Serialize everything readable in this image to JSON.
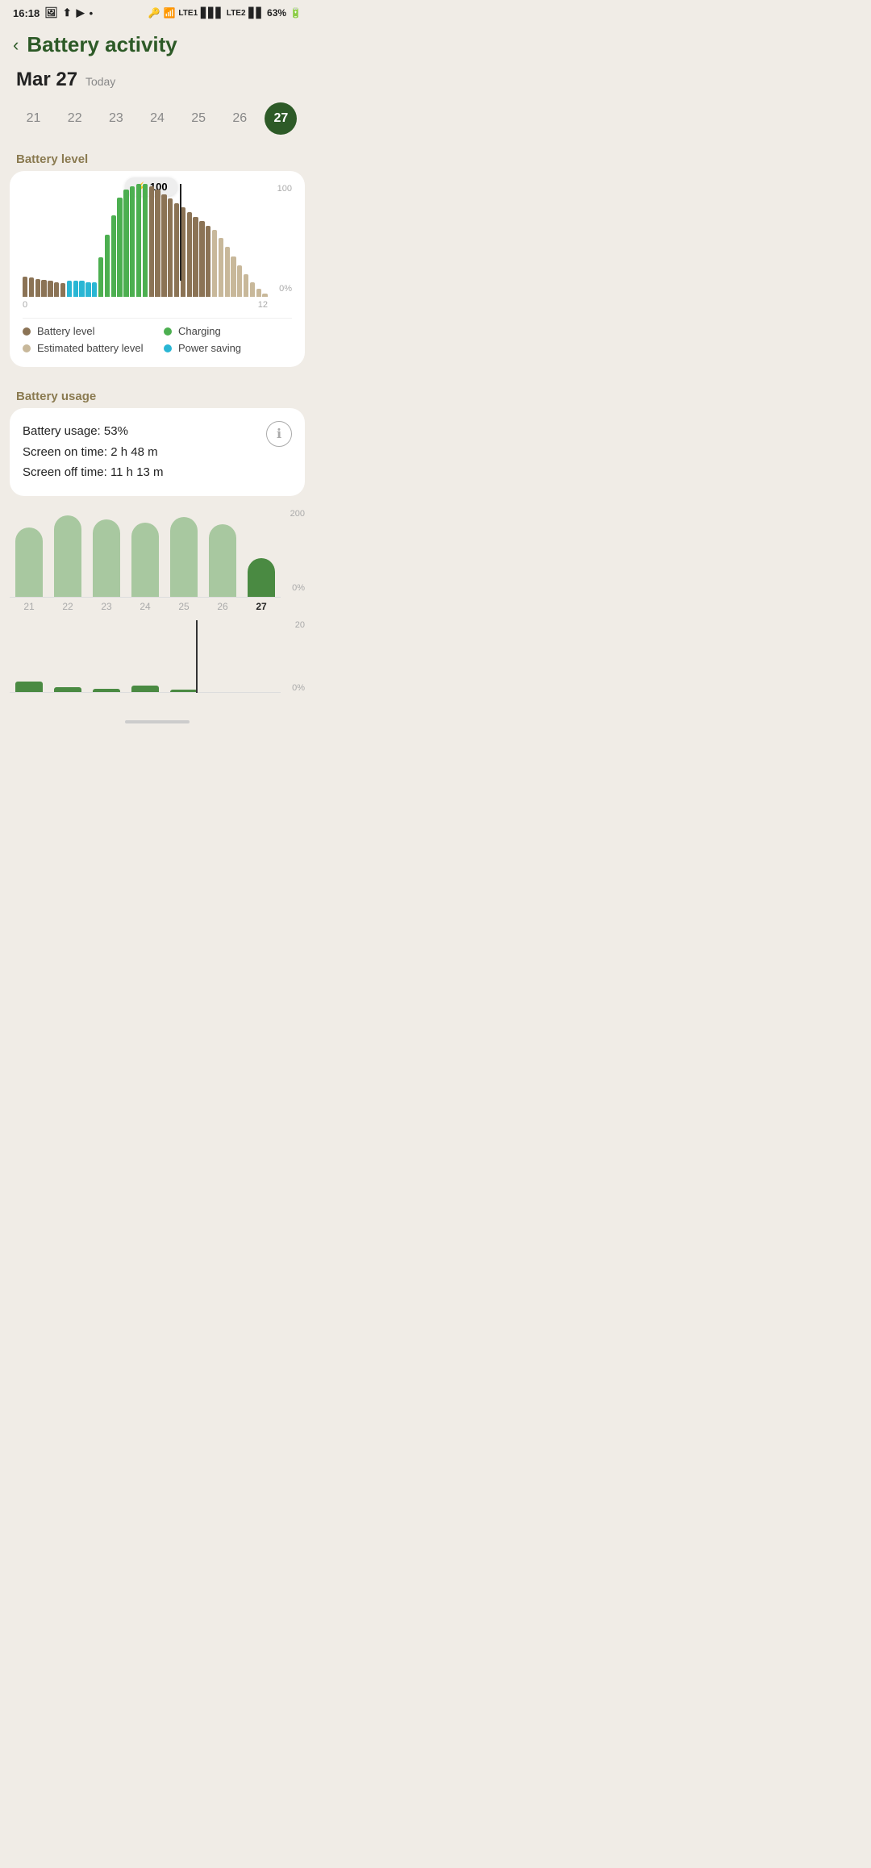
{
  "statusBar": {
    "time": "16:18",
    "battery": "63%"
  },
  "header": {
    "backLabel": "‹",
    "title": "Battery activity"
  },
  "dateSection": {
    "dateMain": "Mar 27",
    "dateSub": "Today"
  },
  "daySelector": {
    "days": [
      "21",
      "22",
      "23",
      "24",
      "25",
      "26",
      "27"
    ],
    "activeDay": "27"
  },
  "batteryLevelSection": {
    "label": "Battery level",
    "tooltip": "⚡ 100",
    "yLabelTop": "100",
    "yLabelBottom": "0%",
    "xLabelStart": "0",
    "xLabelMid": "12",
    "legend": [
      {
        "color": "#8b7355",
        "label": "Battery level"
      },
      {
        "color": "#4caf50",
        "label": "Charging"
      },
      {
        "color": "#c8b89a",
        "label": "Estimated battery level"
      },
      {
        "color": "#29b6d4",
        "label": "Power saving"
      }
    ]
  },
  "batteryUsageSection": {
    "label": "Battery usage",
    "usagePercent": "Battery usage: 53%",
    "screenOn": "Screen on time: 2 h 48 m",
    "screenOff": "Screen off time: 11 h 13 m",
    "chart1YTop": "200",
    "chart1YBottom": "0%",
    "chart2YTop": "20",
    "chart2YBottom": "0%",
    "xLabels": [
      "21",
      "22",
      "23",
      "24",
      "25",
      "26",
      "27"
    ]
  }
}
